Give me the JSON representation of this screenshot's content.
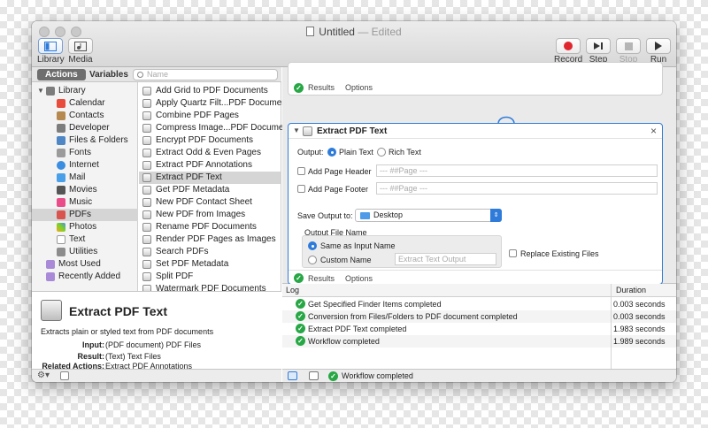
{
  "window": {
    "title": "Untitled",
    "title_suffix": "— Edited"
  },
  "toolbar": {
    "library": "Library",
    "media": "Media",
    "record": "Record",
    "step": "Step",
    "stop": "Stop",
    "run": "Run"
  },
  "tabs": {
    "actions": "Actions",
    "variables": "Variables"
  },
  "search": {
    "placeholder": "Name"
  },
  "library": {
    "root": "Library",
    "items": [
      "Calendar",
      "Contacts",
      "Developer",
      "Files & Folders",
      "Fonts",
      "Internet",
      "Mail",
      "Movies",
      "Music",
      "PDFs",
      "Photos",
      "Text",
      "Utilities"
    ],
    "selected": "PDFs",
    "most_used": "Most Used",
    "recently_added": "Recently Added"
  },
  "actions": {
    "items": [
      "Add Grid to PDF Documents",
      "Apply Quartz Filt...PDF Documents",
      "Combine PDF Pages",
      "Compress Image...PDF Documents",
      "Encrypt PDF Documents",
      "Extract Odd & Even Pages",
      "Extract PDF Annotations",
      "Extract PDF Text",
      "Get PDF Metadata",
      "New PDF Contact Sheet",
      "New PDF from Images",
      "Rename PDF Documents",
      "Render PDF Pages as Images",
      "Search PDFs",
      "Set PDF Metadata",
      "Split PDF",
      "Watermark PDF Documents"
    ],
    "selected": "Extract PDF Text"
  },
  "description": {
    "title": "Extract PDF Text",
    "text": "Extracts plain or styled text from PDF documents",
    "input_label": "Input:",
    "input_value": "(PDF document) PDF Files",
    "result_label": "Result:",
    "result_value": "(Text) Text Files",
    "related_label": "Related Actions:",
    "related_value": "Extract PDF Annotations"
  },
  "workflow": {
    "results": "Results",
    "options": "Options",
    "card": {
      "title": "Extract PDF Text",
      "close": "×",
      "output_label": "Output:",
      "plain_text": "Plain Text",
      "rich_text": "Rich Text",
      "add_header": "Add Page Header",
      "header_placeholder": "--- ##Page ---",
      "add_footer": "Add Page Footer",
      "footer_placeholder": "--- ##Page ---",
      "save_output_label": "Save Output to:",
      "save_output_value": "Desktop",
      "output_file_name": "Output File Name",
      "same_as_input": "Same as Input Name",
      "custom_name": "Custom Name",
      "custom_placeholder": "Extract Text Output",
      "replace_existing": "Replace Existing Files"
    }
  },
  "log": {
    "col_log": "Log",
    "col_duration": "Duration",
    "rows": [
      {
        "message": "Get Specified Finder Items completed",
        "duration": "0.003 seconds"
      },
      {
        "message": "Conversion from Files/Folders to PDF document completed",
        "duration": "0.003 seconds"
      },
      {
        "message": "Extract PDF Text completed",
        "duration": "1.983 seconds"
      },
      {
        "message": "Workflow completed",
        "duration": "1.989 seconds"
      }
    ]
  },
  "status": {
    "text": "Workflow completed"
  },
  "colors": {
    "accent": "#2f7bd9",
    "success": "#27a745",
    "record": "#e0262d"
  }
}
